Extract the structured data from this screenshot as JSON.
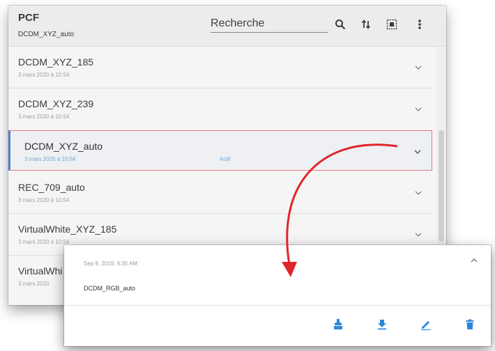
{
  "header": {
    "title": "PCF",
    "subtitle": "DCDM_XYZ_auto",
    "search_placeholder": "Recherche",
    "icons": [
      "search-icon",
      "sort-icon",
      "select-all-icon",
      "more-vert-icon"
    ]
  },
  "list": {
    "items": [
      {
        "name": "DCDM_XYZ_185",
        "date": "3 mars 2020 à 10:54",
        "status": ""
      },
      {
        "name": "DCDM_XYZ_239",
        "date": "3 mars 2020 à 10:54",
        "status": ""
      },
      {
        "name": "DCDM_XYZ_auto",
        "date": "3 mars 2020 à 10:54",
        "status": "Actif"
      },
      {
        "name": "REC_709_auto",
        "date": "3 mars 2020 à 10:54",
        "status": ""
      },
      {
        "name": "VirtualWhite_XYZ_185",
        "date": "3 mars 2020 à 10:54",
        "status": ""
      },
      {
        "name": "VirtualWhi",
        "date": "3 mars 2020",
        "status": ""
      }
    ]
  },
  "popup": {
    "date": "Sep 9, 2019, 9:35 AM",
    "name": "DCDM_RGB_auto",
    "actions": [
      "install-icon",
      "download-icon",
      "edit-icon",
      "delete-icon"
    ]
  },
  "colors": {
    "accent": "#2d86d8",
    "selection_border": "#e07a7a",
    "selection_bar": "#5a7ec2",
    "arrow": "#e0252b"
  }
}
